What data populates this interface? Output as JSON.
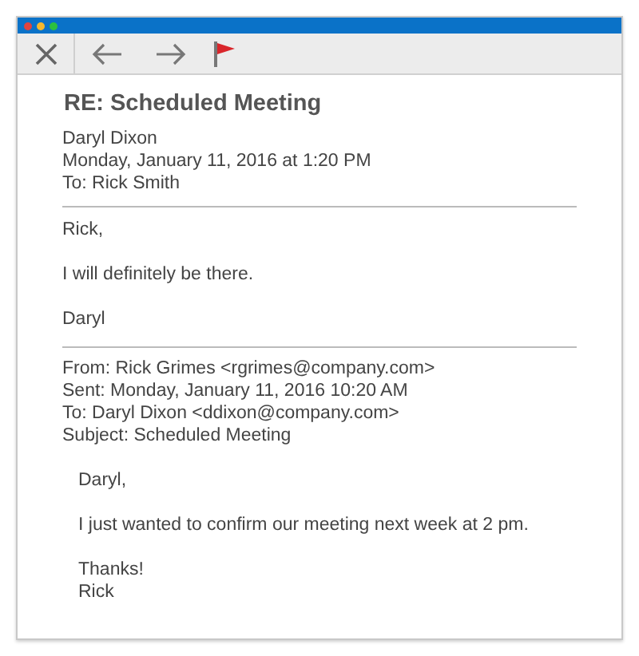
{
  "message": {
    "subject": "RE: Scheduled Meeting",
    "header": [
      "Daryl Dixon",
      "Monday, January 11, 2016 at 1:20 PM",
      "To: Rick Smith"
    ],
    "body": [
      [
        "Rick,"
      ],
      [
        "I will definitely be there."
      ],
      [
        "Daryl"
      ]
    ]
  },
  "quoted": {
    "header": [
      "From: Rick Grimes <rgrimes@company.com>",
      "Sent: Monday, January 11, 2016 10:20 AM",
      "To: Daryl Dixon <ddixon@company.com>",
      "Subject: Scheduled Meeting"
    ],
    "body": [
      [
        "Daryl,"
      ],
      [
        "I just wanted to confirm our meeting next week at 2 pm."
      ],
      [
        "Thanks!",
        "Rick"
      ]
    ]
  }
}
